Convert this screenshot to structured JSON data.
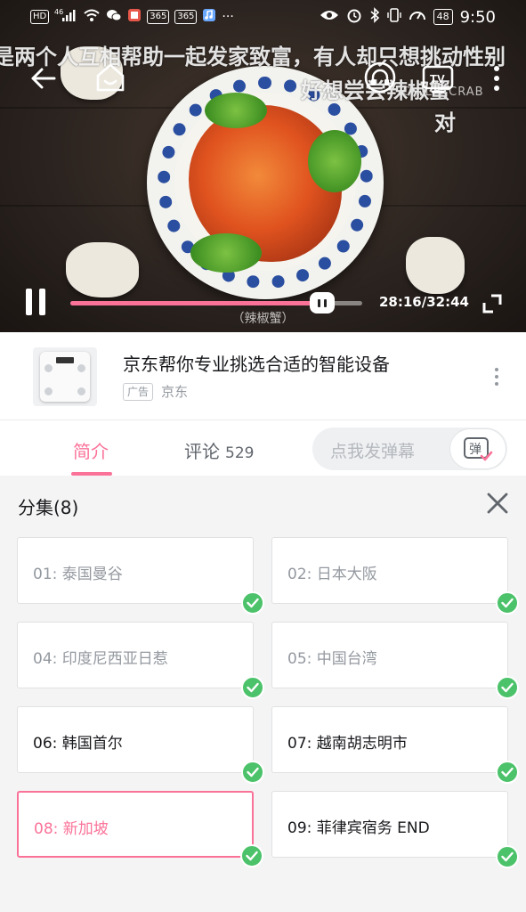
{
  "status_bar": {
    "left_labels": [
      "HD",
      "46",
      "365",
      "365"
    ],
    "overflow": "···",
    "battery": "48",
    "time": "9:50"
  },
  "video": {
    "danmaku": [
      "是两个人互相帮助一起发家致富，有人却只想挑动性别",
      "好想尝尝辣椒蟹",
      "对"
    ],
    "watermark": "CHILLI CRAB",
    "subtitle": "（辣椒蟹）",
    "time_display": "28:16/32:44",
    "progress_fraction": 0.8635
  },
  "ad": {
    "title": "京东帮你专业挑选合适的智能设备",
    "tag": "广告",
    "source": "京东"
  },
  "tabs": {
    "intro": "简介",
    "comments": "评论",
    "comments_count": "529",
    "danmaku_placeholder": "点我发弹幕",
    "danmaku_icon_label": "弹"
  },
  "episodes": {
    "title": "分集(8)",
    "items": [
      {
        "label": "01:  泰国曼谷",
        "state": "watched"
      },
      {
        "label": "02:  日本大阪",
        "state": "watched"
      },
      {
        "label": "04:  印度尼西亚日惹",
        "state": "watched"
      },
      {
        "label": "05:  中国台湾",
        "state": "watched"
      },
      {
        "label": "06:  韩国首尔",
        "state": "normal"
      },
      {
        "label": "07:  越南胡志明市",
        "state": "normal"
      },
      {
        "label": "08:  新加坡",
        "state": "current"
      },
      {
        "label": "09:  菲律宾宿务 END",
        "state": "normal"
      }
    ]
  },
  "colors": {
    "accent": "#fb7299",
    "check": "#4cc26a"
  }
}
